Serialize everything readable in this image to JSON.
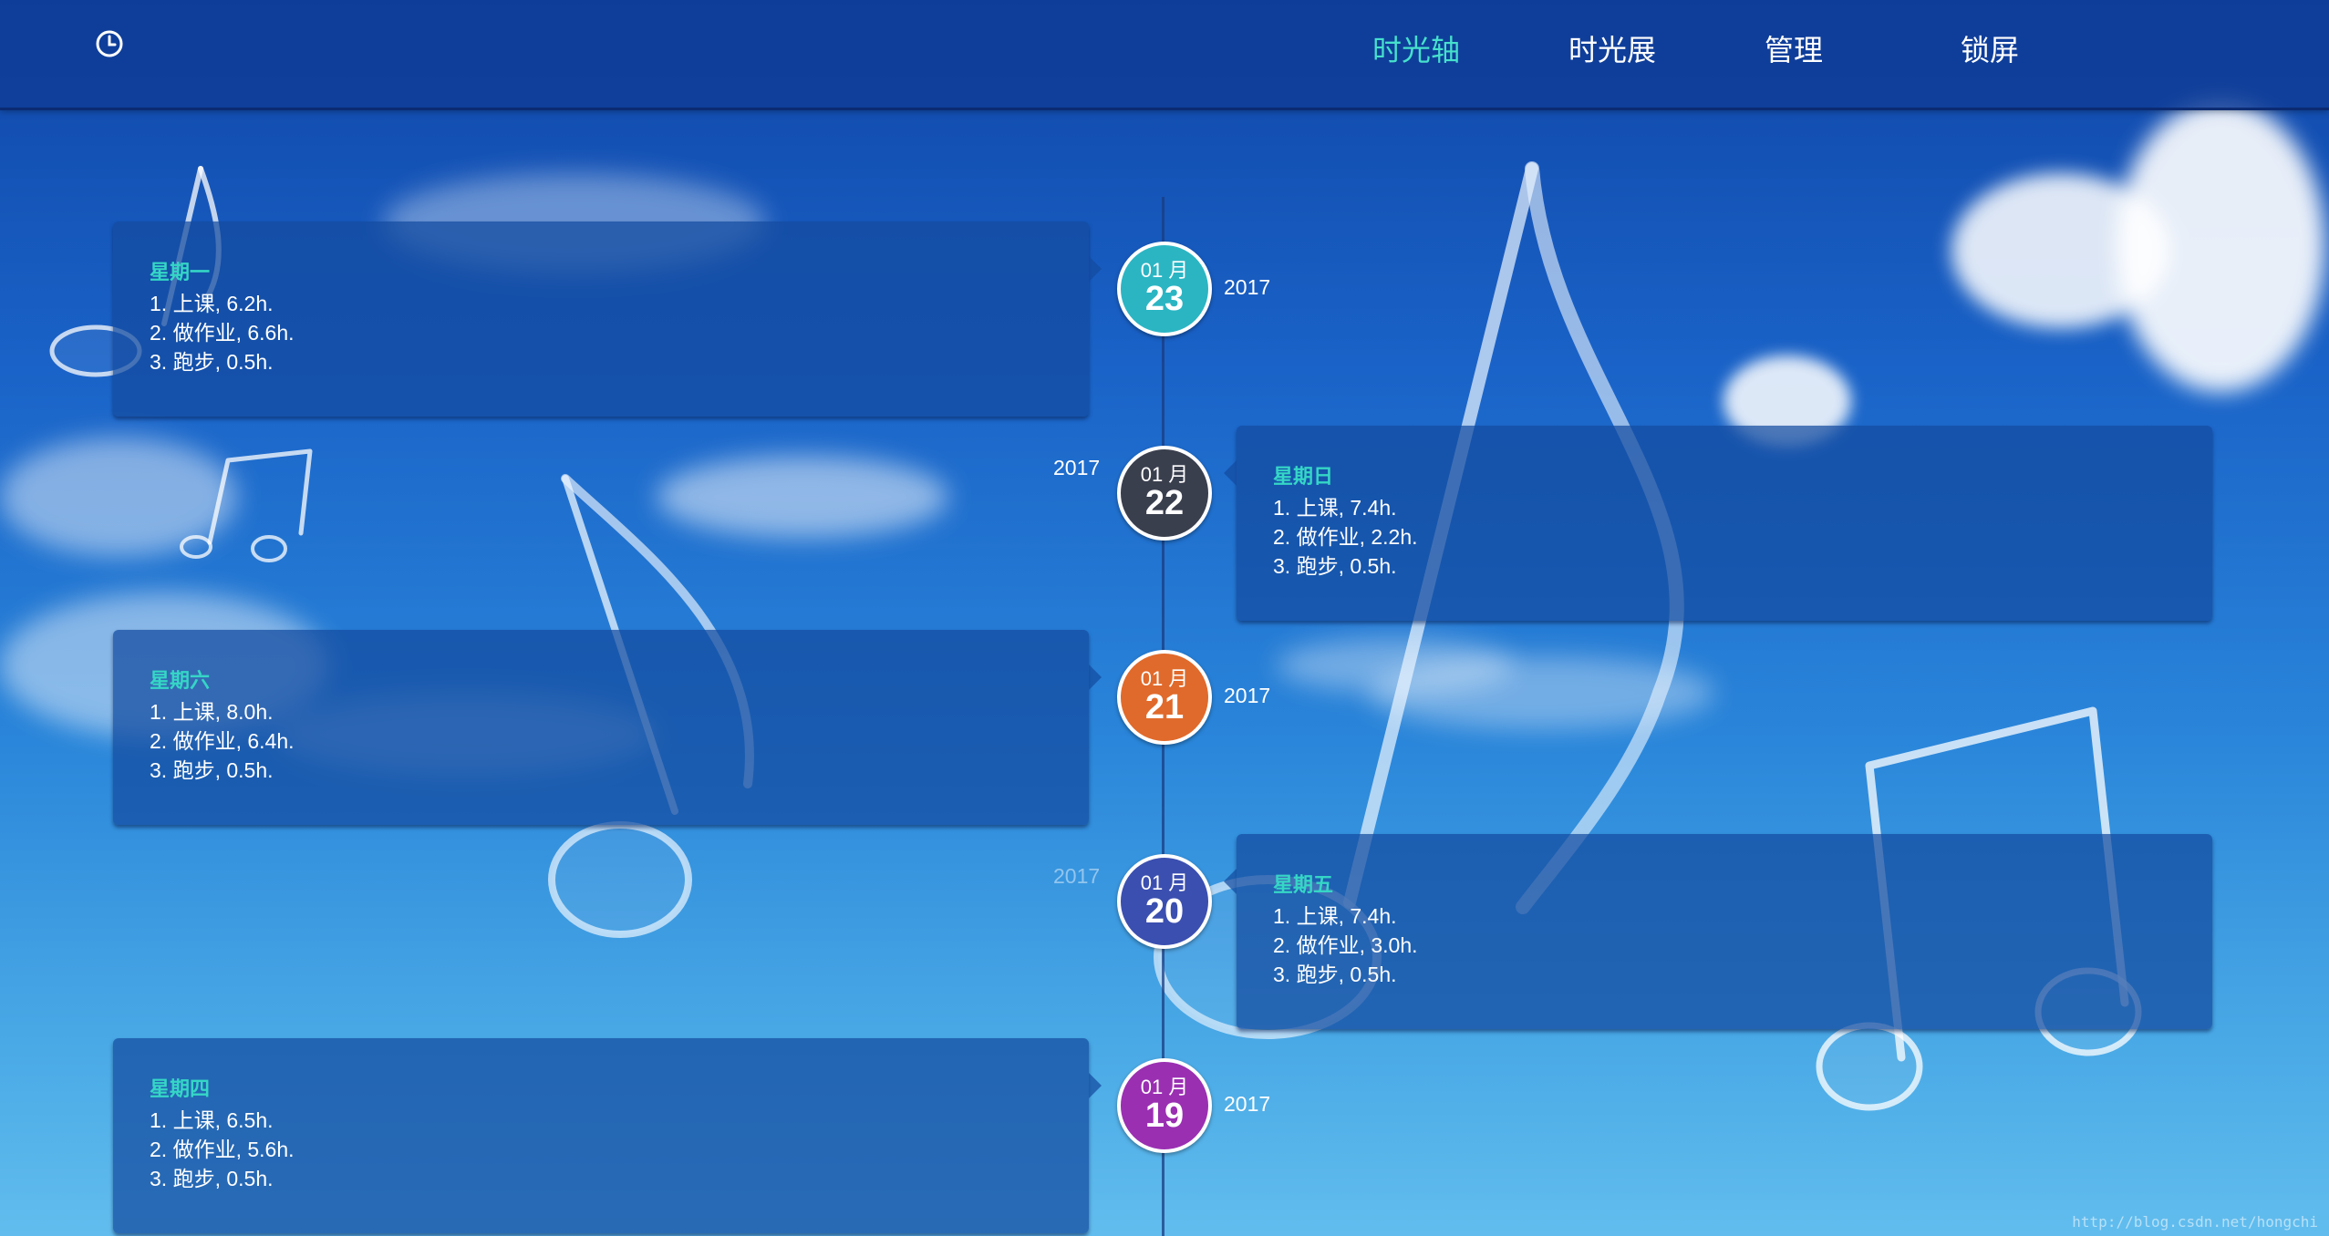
{
  "header": {
    "nav": [
      {
        "label": "时光轴",
        "active": true
      },
      {
        "label": "时光展",
        "active": false
      },
      {
        "label": "管理",
        "active": false
      },
      {
        "label": "锁屏",
        "active": false
      }
    ]
  },
  "timeline": [
    {
      "month": "01 月",
      "day": "23",
      "year": "2017",
      "weekday": "星期一",
      "color": "#2bb5c3",
      "tasks": [
        "1. 上课, 6.2h.",
        "2. 做作业, 6.6h.",
        "3. 跑步, 0.5h."
      ]
    },
    {
      "month": "01 月",
      "day": "22",
      "year": "2017",
      "weekday": "星期日",
      "color": "#3a3f4e",
      "tasks": [
        "1. 上课, 7.4h.",
        "2. 做作业, 2.2h.",
        "3. 跑步, 0.5h."
      ]
    },
    {
      "month": "01 月",
      "day": "21",
      "year": "2017",
      "weekday": "星期六",
      "color": "#e06a2b",
      "tasks": [
        "1. 上课, 8.0h.",
        "2. 做作业, 6.4h.",
        "3. 跑步, 0.5h."
      ]
    },
    {
      "month": "01 月",
      "day": "20",
      "year": "2017",
      "weekday": "星期五",
      "color": "#3b4fb0",
      "tasks": [
        "1. 上课, 7.4h.",
        "2. 做作业, 3.0h.",
        "3. 跑步, 0.5h."
      ]
    },
    {
      "month": "01 月",
      "day": "19",
      "year": "2017",
      "weekday": "星期四",
      "color": "#9a2fb2",
      "tasks": [
        "1. 上课, 6.5h.",
        "2. 做作业, 5.6h.",
        "3. 跑步, 0.5h."
      ]
    }
  ],
  "watermark": "http://blog.csdn.net/hongchi"
}
